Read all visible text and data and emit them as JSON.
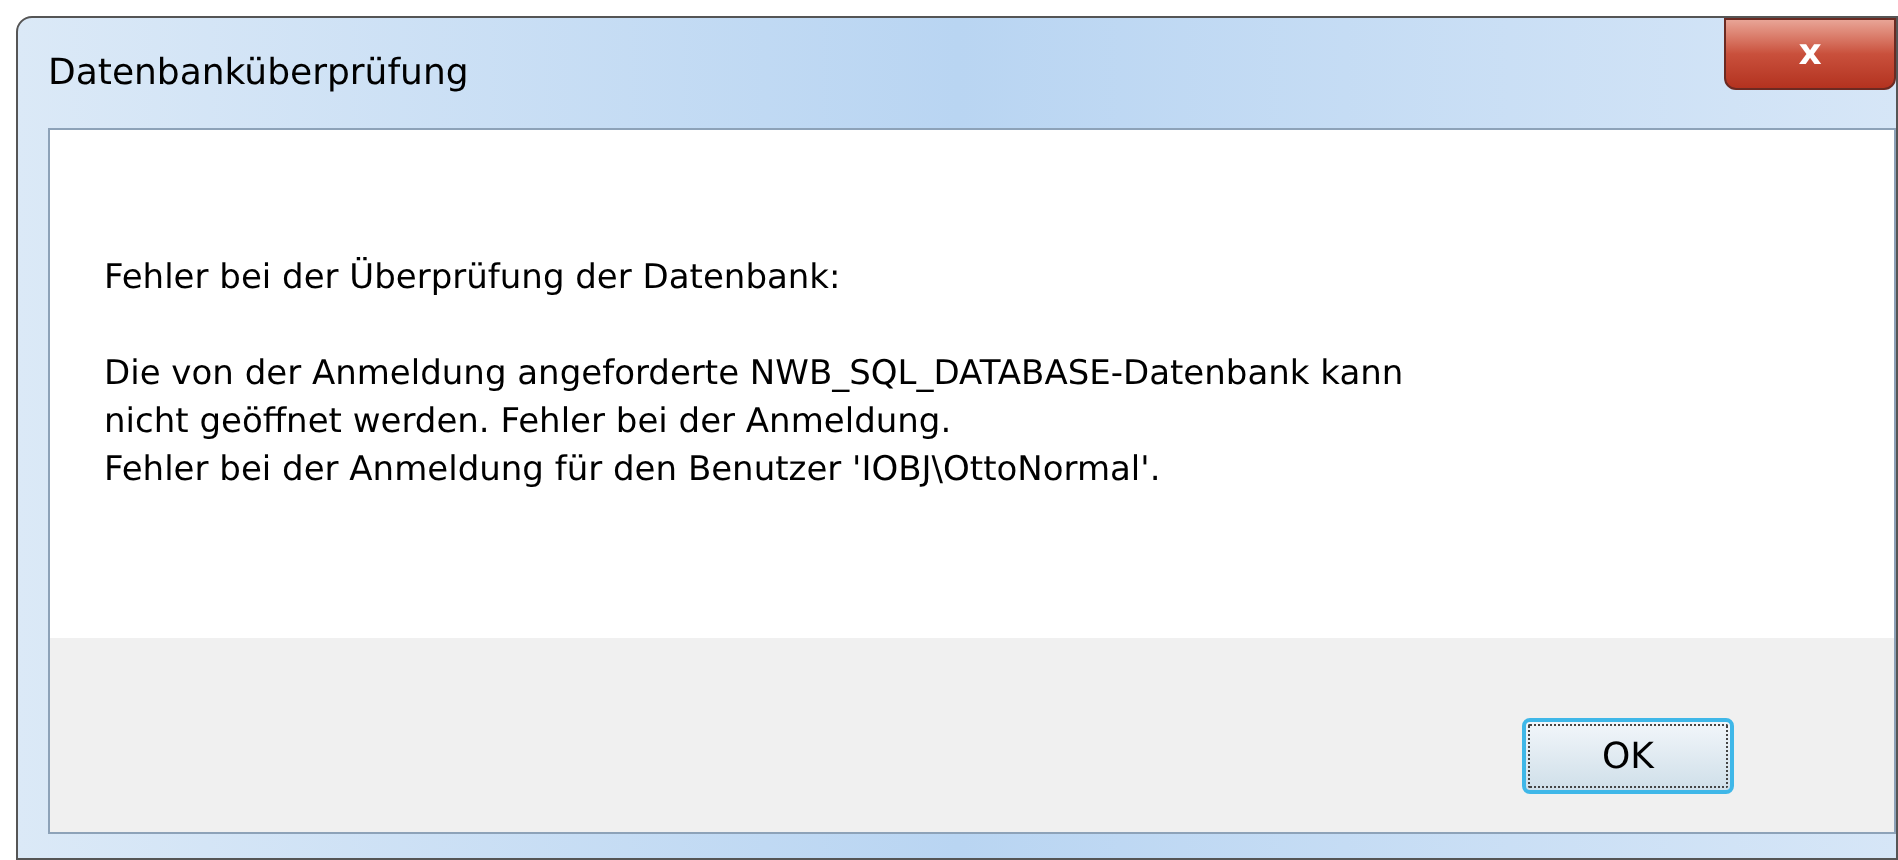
{
  "window": {
    "title": "Datenbanküberprüfung",
    "close_label": "x"
  },
  "message": {
    "heading": "Fehler bei der Überprüfung der Datenbank:",
    "lines": [
      "Die von der Anmeldung angeforderte NWB_SQL_DATABASE-Datenbank kann",
      "nicht geöffnet werden. Fehler bei der Anmeldung.",
      "Fehler bei der Anmeldung für den Benutzer 'IOBJ\\OttoNormal'."
    ]
  },
  "buttons": [
    {
      "label": "OK",
      "focused": true
    }
  ]
}
